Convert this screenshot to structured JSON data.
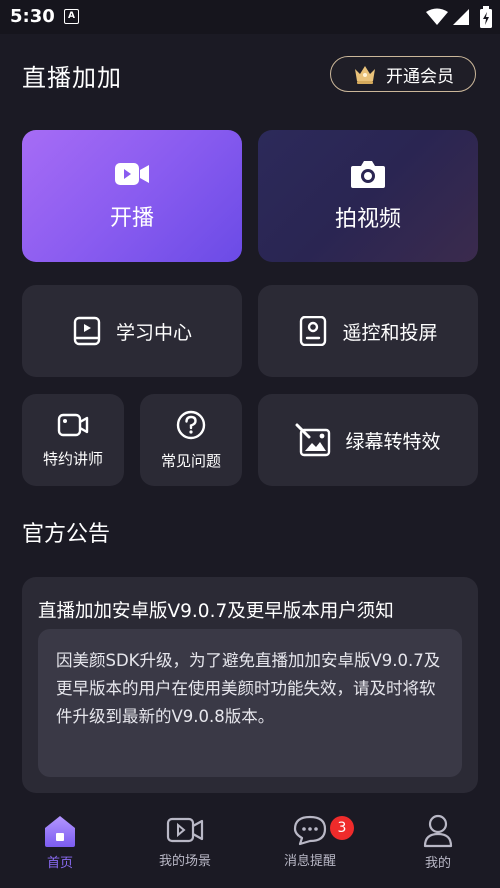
{
  "status_bar": {
    "time": "5:30",
    "notification_icon_letter": "A"
  },
  "header": {
    "title": "直播加加",
    "vip_label": "开通会员"
  },
  "cards": {
    "start_live": "开播",
    "shoot_video": "拍视频",
    "learning_center": "学习中心",
    "remote_cast": "遥控和投屏",
    "lecturer": "特约讲师",
    "faq": "常见问题",
    "green_screen": "绿幕转特效"
  },
  "notice": {
    "section_title": "官方公告",
    "title": "直播加加安卓版V9.0.7及更早版本用户须知",
    "body": "因美颜SDK升级，为了避免直播加加安卓版V9.0.7及更早版本的用户在使用美颜时功能失效，请及时将软件升级到最新的V9.0.8版本。"
  },
  "tabs": [
    {
      "label": "首页",
      "icon": "home-icon",
      "active": true
    },
    {
      "label": "我的场景",
      "icon": "video-icon"
    },
    {
      "label": "消息提醒",
      "icon": "message-icon",
      "badge": "3"
    },
    {
      "label": "我的",
      "icon": "user-icon"
    }
  ],
  "colors": {
    "accent": "#8a6bf3",
    "badge": "#ef2b2b",
    "background": "#1b1a24",
    "card": "#2b2a35"
  }
}
